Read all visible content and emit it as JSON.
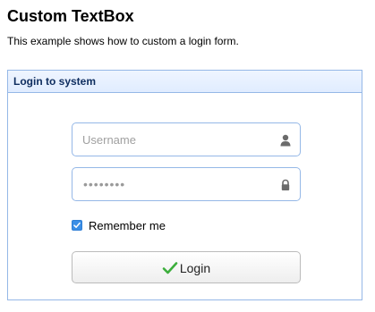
{
  "page": {
    "title": "Custom TextBox",
    "description": "This example shows how to custom a login form."
  },
  "panel": {
    "title": "Login to system"
  },
  "form": {
    "username": {
      "placeholder": "Username",
      "value": "",
      "icon": "user-icon"
    },
    "password": {
      "masked_value": "••••••••",
      "icon": "lock-icon"
    },
    "remember": {
      "label": "Remember me",
      "checked": true
    },
    "submit": {
      "label": "Login",
      "icon": "check-icon"
    }
  },
  "colors": {
    "panel_border": "#95b8e7",
    "panel_header_text": "#0e2d5f",
    "checkbox": "#3a8ee6",
    "check_icon": "#3cae3c"
  }
}
